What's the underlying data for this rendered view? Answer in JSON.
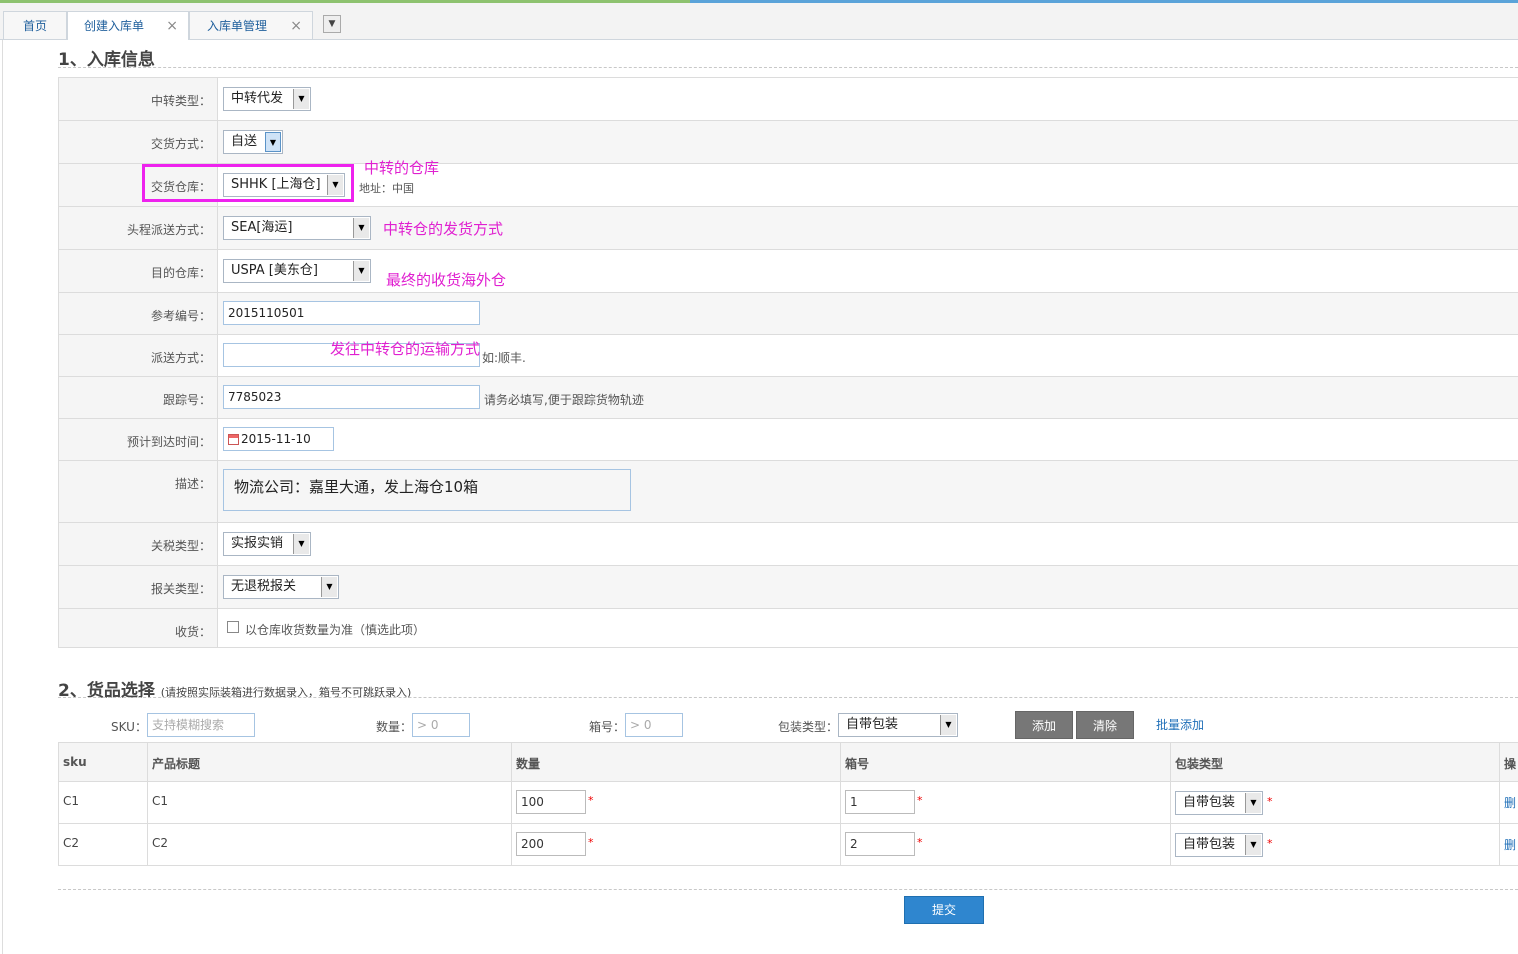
{
  "tabs": {
    "home": "首页",
    "create": "创建入库单",
    "manage": "入库单管理",
    "close": "×",
    "dropdown": "▼"
  },
  "section1": {
    "title": "1、入库信息"
  },
  "form": {
    "transfer_type": {
      "label": "中转类型：",
      "value": "中转代发"
    },
    "delivery_method": {
      "label": "交货方式：",
      "value": "自送"
    },
    "delivery_warehouse": {
      "label": "交货仓库：",
      "value": "SHHK [上海仓]",
      "address": "地址：中国"
    },
    "first_leg": {
      "label": "头程派送方式：",
      "value": "SEA[海运]"
    },
    "dest_warehouse": {
      "label": "目的仓库：",
      "value": "USPA [美东仓]"
    },
    "ref_no": {
      "label": "参考编号：",
      "value": "2015110501"
    },
    "dispatch_method": {
      "label": "派送方式：",
      "value": "",
      "hint": "如:顺丰."
    },
    "tracking_no": {
      "label": "跟踪号：",
      "value": "7785023",
      "hint": "请务必填写,便于跟踪货物轨迹"
    },
    "eta": {
      "label": "预计到达时间：",
      "value": "2015-11-10"
    },
    "description": {
      "label": "描述：",
      "value": "物流公司：嘉里大通，发上海仓10箱"
    },
    "tax_type": {
      "label": "关税类型：",
      "value": "实报实销"
    },
    "customs_type": {
      "label": "报关类型：",
      "value": "无退税报关"
    },
    "receipt": {
      "label": "收货：",
      "option": "以仓库收货数量为准（慎选此项）"
    }
  },
  "annotations": {
    "a1": "中转的仓库",
    "a2": "中转仓的发货方式",
    "a3": "最终的收货海外仓",
    "a4": "发往中转仓的运输方式"
  },
  "section2": {
    "title": "2、货品选择",
    "subtitle": "(请按照实际装箱进行数据录入，箱号不可跳跃录入)"
  },
  "filters": {
    "sku_label": "SKU：",
    "sku_placeholder": "支持模糊搜索",
    "qty_label": "数量：",
    "qty_placeholder": "> 0",
    "box_label": "箱号：",
    "box_placeholder": "> 0",
    "pack_label": "包装类型：",
    "pack_value": "自带包装",
    "add": "添加",
    "clear": "清除",
    "batch_add": "批量添加"
  },
  "table": {
    "headers": [
      "sku",
      "产品标题",
      "数量",
      "箱号",
      "包装类型",
      "操"
    ],
    "rows": [
      {
        "sku": "C1",
        "title": "C1",
        "qty": "100",
        "box": "1",
        "pack": "自带包装",
        "op": "删"
      },
      {
        "sku": "C2",
        "title": "C2",
        "qty": "200",
        "box": "2",
        "pack": "自带包装",
        "op": "删"
      }
    ],
    "required_star": "*"
  },
  "submit": "提交"
}
